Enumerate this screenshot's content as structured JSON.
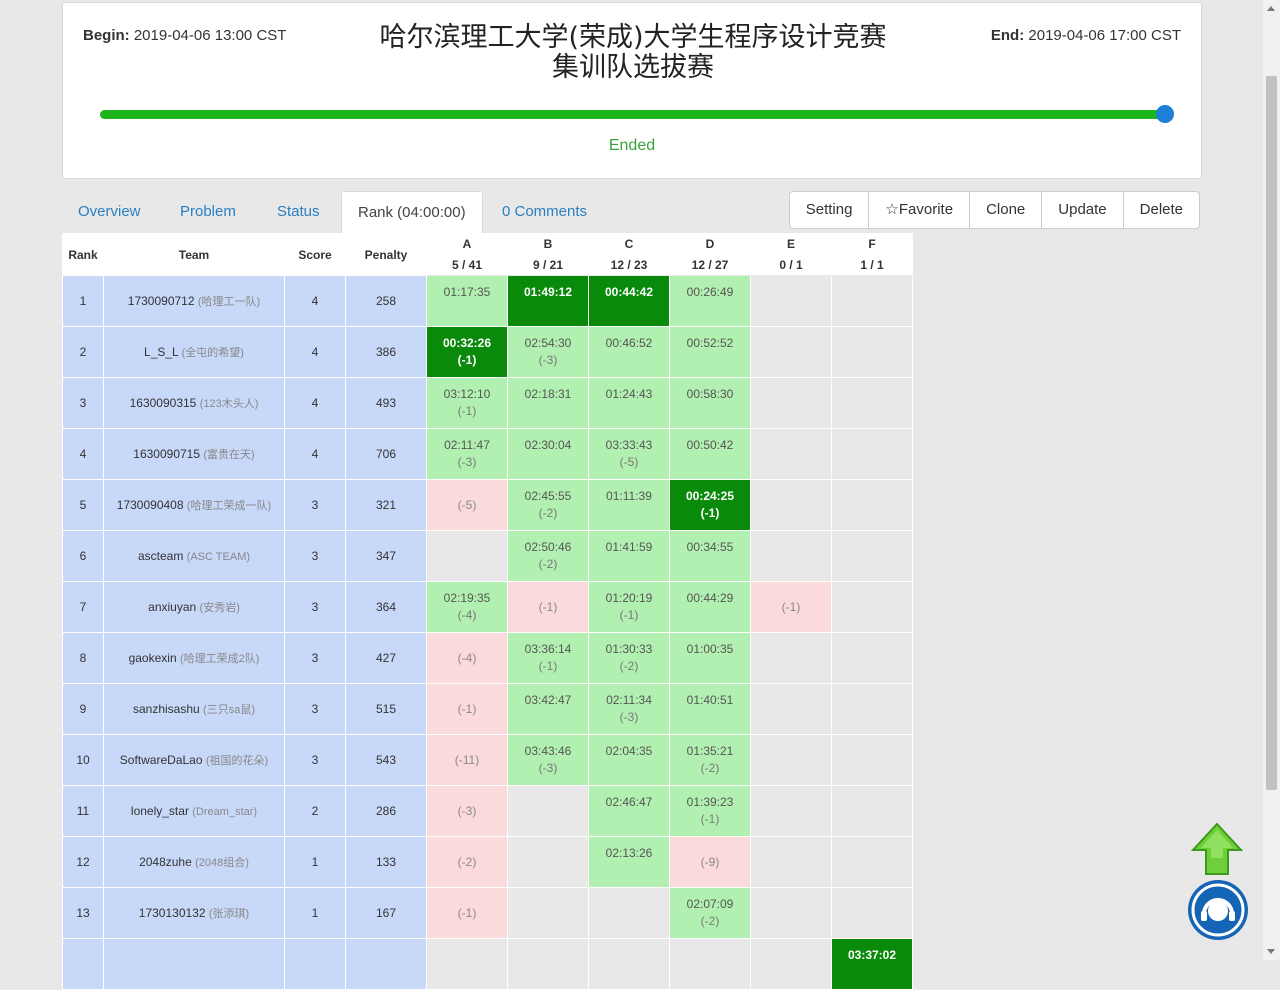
{
  "contest": {
    "begin_label": "Begin:",
    "begin_time": "2019-04-06 13:00 CST",
    "end_label": "End:",
    "end_time": "2019-04-06 17:00 CST",
    "title_line1": "哈尔滨理工大学(荣成)大学生程序设计竞赛",
    "title_line2": "集训队选拔赛",
    "progress": 1.0,
    "status": "Ended",
    "accent_color": "#1cb51c"
  },
  "tabs": [
    {
      "label": "Overview"
    },
    {
      "label": "Problem"
    },
    {
      "label": "Status"
    },
    {
      "label": "Rank (04:00:00)",
      "active": true
    },
    {
      "label": "0 Comments"
    }
  ],
  "actions": [
    "Setting",
    "☆Favorite",
    "Clone",
    "Update",
    "Delete"
  ],
  "table": {
    "headers": {
      "rank": "Rank",
      "team": "Team",
      "score": "Score",
      "penalty": "Penalty"
    },
    "problems": [
      {
        "letter": "A",
        "stat": "5 / 41"
      },
      {
        "letter": "B",
        "stat": "9 / 21"
      },
      {
        "letter": "C",
        "stat": "12 / 23"
      },
      {
        "letter": "D",
        "stat": "12 / 27"
      },
      {
        "letter": "E",
        "stat": "0 / 1"
      },
      {
        "letter": "F",
        "stat": "1 / 1"
      }
    ],
    "rows": [
      {
        "rank": "1",
        "user": "1730090712",
        "nick": "(哈理工一队)",
        "score": "4",
        "penalty": "258",
        "cells": [
          [
            "ac",
            "01:17:35",
            ""
          ],
          [
            "fb",
            "01:49:12",
            ""
          ],
          [
            "fb",
            "00:44:42",
            ""
          ],
          [
            "ac",
            "00:26:49",
            ""
          ],
          [
            "",
            "",
            ""
          ],
          [
            "",
            "",
            ""
          ]
        ]
      },
      {
        "rank": "2",
        "user": "L_S_L",
        "nick": "(全屯的希望)",
        "score": "4",
        "penalty": "386",
        "cells": [
          [
            "fb",
            "00:32:26",
            "(-1)"
          ],
          [
            "ac",
            "02:54:30",
            "(-3)"
          ],
          [
            "ac",
            "00:46:52",
            ""
          ],
          [
            "ac",
            "00:52:52",
            ""
          ],
          [
            "",
            "",
            ""
          ],
          [
            "",
            "",
            ""
          ]
        ]
      },
      {
        "rank": "3",
        "user": "1630090315",
        "nick": "(123木头人)",
        "score": "4",
        "penalty": "493",
        "cells": [
          [
            "ac",
            "03:12:10",
            "(-1)"
          ],
          [
            "ac",
            "02:18:31",
            ""
          ],
          [
            "ac",
            "01:24:43",
            ""
          ],
          [
            "ac",
            "00:58:30",
            ""
          ],
          [
            "",
            "",
            ""
          ],
          [
            "",
            "",
            ""
          ]
        ]
      },
      {
        "rank": "4",
        "user": "1630090715",
        "nick": "(富贵在天)",
        "score": "4",
        "penalty": "706",
        "cells": [
          [
            "ac",
            "02:11:47",
            "(-3)"
          ],
          [
            "ac",
            "02:30:04",
            ""
          ],
          [
            "ac",
            "03:33:43",
            "(-5)"
          ],
          [
            "ac",
            "00:50:42",
            ""
          ],
          [
            "",
            "",
            ""
          ],
          [
            "",
            "",
            ""
          ]
        ]
      },
      {
        "rank": "5",
        "user": "1730090408",
        "nick": "(哈理工荣成一队)",
        "score": "3",
        "penalty": "321",
        "cells": [
          [
            "wa",
            "",
            "(-5)"
          ],
          [
            "ac",
            "02:45:55",
            "(-2)"
          ],
          [
            "ac",
            "01:11:39",
            ""
          ],
          [
            "fb",
            "00:24:25",
            "(-1)"
          ],
          [
            "",
            "",
            ""
          ],
          [
            "",
            "",
            ""
          ]
        ]
      },
      {
        "rank": "6",
        "user": "ascteam",
        "nick": "(ASC TEAM)",
        "score": "3",
        "penalty": "347",
        "cells": [
          [
            "",
            "",
            ""
          ],
          [
            "ac",
            "02:50:46",
            "(-2)"
          ],
          [
            "ac",
            "01:41:59",
            ""
          ],
          [
            "ac",
            "00:34:55",
            ""
          ],
          [
            "",
            "",
            ""
          ],
          [
            "",
            "",
            ""
          ]
        ]
      },
      {
        "rank": "7",
        "user": "anxiuyan",
        "nick": "(安秀岩)",
        "score": "3",
        "penalty": "364",
        "cells": [
          [
            "ac",
            "02:19:35",
            "(-4)"
          ],
          [
            "wa",
            "",
            "(-1)"
          ],
          [
            "ac",
            "01:20:19",
            "(-1)"
          ],
          [
            "ac",
            "00:44:29",
            ""
          ],
          [
            "wa",
            "",
            "(-1)"
          ],
          [
            "",
            "",
            ""
          ]
        ]
      },
      {
        "rank": "8",
        "user": "gaokexin",
        "nick": "(哈理工荣成2队)",
        "score": "3",
        "penalty": "427",
        "cells": [
          [
            "wa",
            "",
            "(-4)"
          ],
          [
            "ac",
            "03:36:14",
            "(-1)"
          ],
          [
            "ac",
            "01:30:33",
            "(-2)"
          ],
          [
            "ac",
            "01:00:35",
            ""
          ],
          [
            "",
            "",
            ""
          ],
          [
            "",
            "",
            ""
          ]
        ]
      },
      {
        "rank": "9",
        "user": "sanzhisashu",
        "nick": "(三只sa鼠)",
        "score": "3",
        "penalty": "515",
        "cells": [
          [
            "wa",
            "",
            "(-1)"
          ],
          [
            "ac",
            "03:42:47",
            ""
          ],
          [
            "ac",
            "02:11:34",
            "(-3)"
          ],
          [
            "ac",
            "01:40:51",
            ""
          ],
          [
            "",
            "",
            ""
          ],
          [
            "",
            "",
            ""
          ]
        ]
      },
      {
        "rank": "10",
        "user": "SoftwareDaLao",
        "nick": "(祖国的花朵)",
        "score": "3",
        "penalty": "543",
        "cells": [
          [
            "wa",
            "",
            "(-11)"
          ],
          [
            "ac",
            "03:43:46",
            "(-3)"
          ],
          [
            "ac",
            "02:04:35",
            ""
          ],
          [
            "ac",
            "01:35:21",
            "(-2)"
          ],
          [
            "",
            "",
            ""
          ],
          [
            "",
            "",
            ""
          ]
        ]
      },
      {
        "rank": "11",
        "user": "lonely_star",
        "nick": "(Dream_star)",
        "score": "2",
        "penalty": "286",
        "cells": [
          [
            "wa",
            "",
            "(-3)"
          ],
          [
            "",
            "",
            ""
          ],
          [
            "ac",
            "02:46:47",
            ""
          ],
          [
            "ac",
            "01:39:23",
            "(-1)"
          ],
          [
            "",
            "",
            ""
          ],
          [
            "",
            "",
            ""
          ]
        ]
      },
      {
        "rank": "12",
        "user": "2048zuhe",
        "nick": "(2048组合)",
        "score": "1",
        "penalty": "133",
        "cells": [
          [
            "wa",
            "",
            "(-2)"
          ],
          [
            "",
            "",
            ""
          ],
          [
            "ac",
            "02:13:26",
            ""
          ],
          [
            "wa",
            "",
            "(-9)"
          ],
          [
            "",
            "",
            ""
          ],
          [
            "",
            "",
            ""
          ]
        ]
      },
      {
        "rank": "13",
        "user": "1730130132",
        "nick": "(张添琪)",
        "score": "1",
        "penalty": "167",
        "cells": [
          [
            "wa",
            "",
            "(-1)"
          ],
          [
            "",
            "",
            ""
          ],
          [
            "",
            "",
            ""
          ],
          [
            "ac",
            "02:07:09",
            "(-2)"
          ],
          [
            "",
            "",
            ""
          ],
          [
            "",
            "",
            ""
          ]
        ]
      },
      {
        "rank": "",
        "user": "",
        "nick": "",
        "score": "",
        "penalty": "",
        "cells": [
          [
            "",
            "",
            ""
          ],
          [
            "",
            "",
            ""
          ],
          [
            "",
            "",
            ""
          ],
          [
            "",
            "",
            ""
          ],
          [
            "",
            "",
            ""
          ],
          [
            "fb",
            "03:37:02",
            ""
          ]
        ]
      }
    ]
  },
  "icons": {
    "back_to_top": "up-arrow-icon",
    "help": "headset-icon"
  }
}
